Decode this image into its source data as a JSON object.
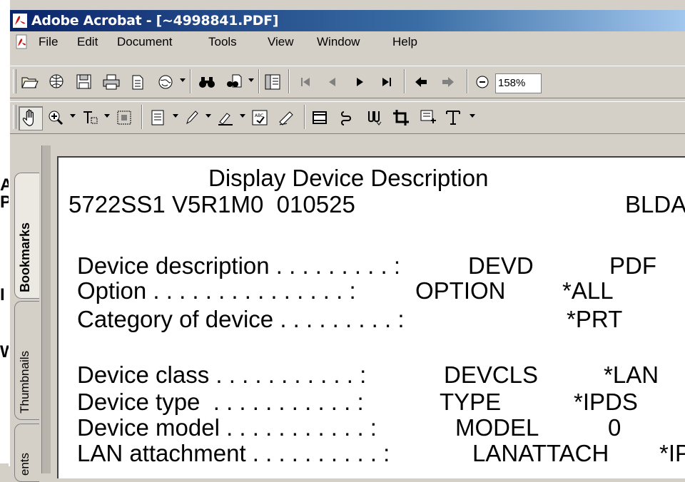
{
  "window": {
    "title": "Adobe Acrobat - [~4998841.PDF]"
  },
  "menu": [
    "File",
    "Edit",
    "Document",
    "Tools",
    "View",
    "Window",
    "Help"
  ],
  "toolbar": {
    "zoom_value": "158%"
  },
  "nav_tabs": [
    "Bookmarks",
    "Thumbnails",
    "ents"
  ],
  "background_fragments": [
    "A",
    "P",
    "I",
    "W"
  ],
  "document": {
    "title": "Display Device Description",
    "header_left": "5722SS1 V5R1M0  010525",
    "header_right": "BLDA",
    "rows": [
      {
        "label": "Device description . . . . . . . . . :",
        "keyword": "DEVD",
        "value": "PDF"
      },
      {
        "label": "Option . . . . . . . . . . . . . . . :",
        "keyword": "OPTION",
        "value": "*ALL"
      },
      {
        "label": "Category of device . . . . . . . . . :",
        "keyword": "",
        "value": "*PRT"
      },
      {
        "label": "Device class . . . . . . . . . . . :",
        "keyword": "DEVCLS",
        "value": "*LAN"
      },
      {
        "label": "Device type  . . . . . . . . . . . :",
        "keyword": "TYPE",
        "value": "*IPDS"
      },
      {
        "label": "Device model . . . . . . . . . . . :",
        "keyword": "MODEL",
        "value": "0"
      },
      {
        "label": "LAN attachment . . . . . . . . . . :",
        "keyword": "LANATTACH",
        "value": "*IP"
      }
    ]
  },
  "colors": {
    "titlebar_start": "#0a246a",
    "titlebar_end": "#a6caf0",
    "chrome": "#d4d0c8"
  },
  "icons": [
    "open-folder-icon",
    "web-capture-icon",
    "save-disk-icon",
    "print-icon",
    "email-icon",
    "web-globe-icon",
    "find-binoculars-icon",
    "search-icon",
    "navigation-pane-icon",
    "first-page-icon",
    "previous-page-icon",
    "next-page-icon",
    "last-page-icon",
    "go-back-icon",
    "go-forward-icon",
    "zoom-out-icon",
    "hand-tool-icon",
    "zoom-in-icon",
    "text-select-icon",
    "graphics-select-icon",
    "note-tool-icon",
    "pencil-icon",
    "highlight-icon",
    "stamp-icon",
    "sign-icon",
    "movie-icon",
    "link-icon",
    "crop-icon",
    "article-icon",
    "touchup-text-icon"
  ]
}
